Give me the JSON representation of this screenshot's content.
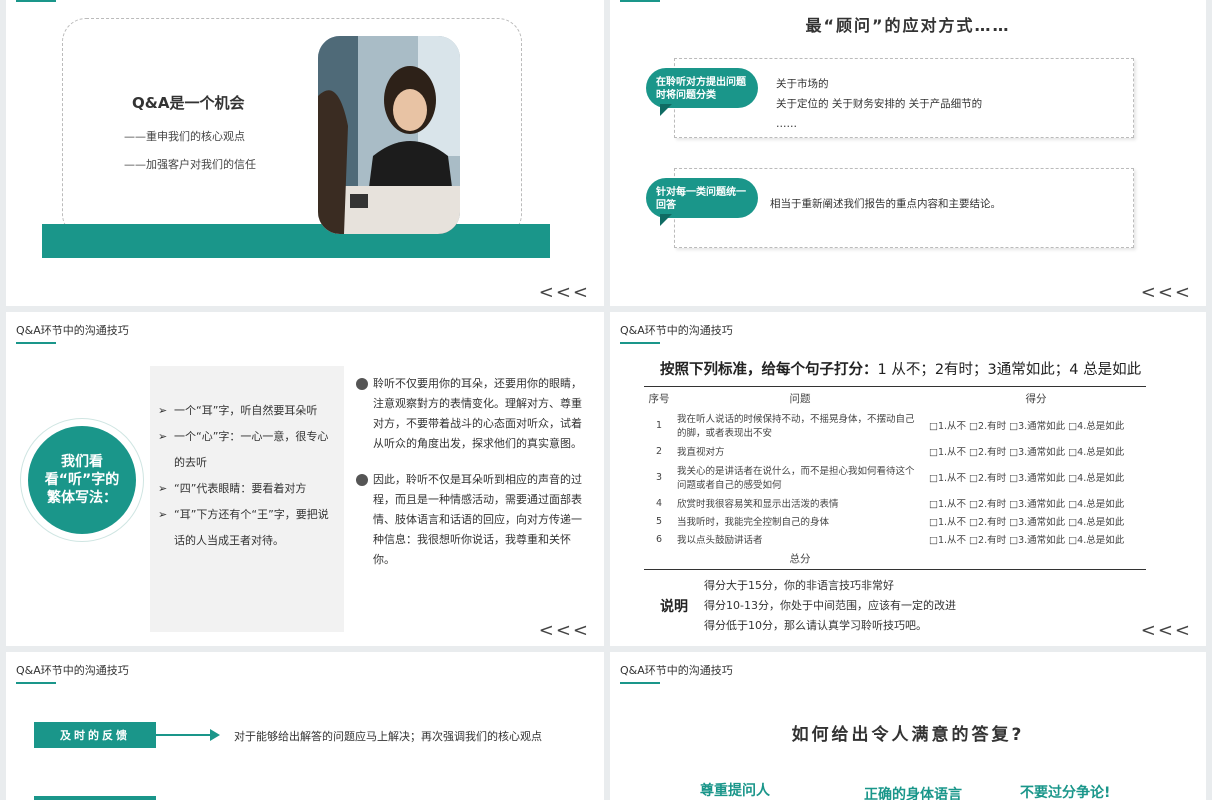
{
  "colors": {
    "accent": "#1a968a",
    "bg": "#e9ecee"
  },
  "nav_arrows": "<<<",
  "slide1": {
    "title": "Q&A是一个机会",
    "lines": [
      "——重申我们的核心观点",
      "——加强客户对我们的信任"
    ]
  },
  "slide2": {
    "title": "最“顾问”的应对方式……",
    "items": [
      {
        "bubble": "在聆听对方提出问题时将问题分类",
        "text": [
          "关于市场的",
          "关于定位的 关于财务安排的 关于产品细节的",
          "……"
        ]
      },
      {
        "bubble": "针对每一类问题统一回答",
        "text": [
          "相当于重新阐述我们报告的重点内容和主要结论。"
        ]
      }
    ]
  },
  "slide3": {
    "header": "Q&A环节中的沟通技巧",
    "circle_text": "我们看看“听”字的繁体写法：",
    "bullets": [
      "一个“耳”字，听自然要耳朵听",
      "一个“心”字：一心一意，很专心的去听",
      "“四”代表眼睛：要看着对方",
      "“耳”下方还有个“王”字，要把说话的人当成王者对待。"
    ],
    "paragraphs": [
      "聆听不仅要用你的耳朵，还要用你的眼睛，注意观察對方的表情变化。理解对方、尊重对方，不要带着战斗的心态面对听众，试着从听众的角度出发，探求他们的真实意图。",
      "因此，聆听不仅是耳朵听到相应的声音的过程，而且是一种情感活动，需要通过面部表情、肢体语言和话语的回应，向对方传递一种信息：我很想听你说话，我尊重和关怀你。"
    ]
  },
  "slide4": {
    "header": "Q&A环节中的沟通技巧",
    "title_bold": "按照下列标准，给每个句子打分：",
    "title_rest": "1 从不；2有时；3通常如此；4 总是如此",
    "columns": [
      "序号",
      "问题",
      "得分"
    ],
    "rows": [
      {
        "no": "1",
        "q": "我在听人说话的时候保持不动，不摇晃身体，不摆动自己的脚，或者表现出不安"
      },
      {
        "no": "2",
        "q": "我直视对方"
      },
      {
        "no": "3",
        "q": "我关心的是讲话者在说什么，而不是担心我如何看待这个问题或者自己的感受如何"
      },
      {
        "no": "4",
        "q": "欣赏时我很容易笑和显示出活泼的表情"
      },
      {
        "no": "5",
        "q": "当我听时，我能完全控制自己的身体"
      },
      {
        "no": "6",
        "q": "我以点头鼓励讲话者"
      }
    ],
    "options": "□1.从不  □2.有时  □3.通常如此  □4.总是如此",
    "total_label": "总分",
    "note_label": "说明",
    "notes": [
      "得分大于15分，你的非语言技巧非常好",
      "得分10-13分，你处于中间范围，应该有一定的改进",
      "得分低于10分，那么请认真学习聆听技巧吧。"
    ]
  },
  "slide5": {
    "header": "Q&A环节中的沟通技巧",
    "tag": "及时的反馈",
    "text": "对于能够给出解答的问题应马上解决；再次强调我们的核心观点"
  },
  "slide6": {
    "header": "Q&A环节中的沟通技巧",
    "title": "如何给出令人满意的答复?",
    "items": [
      "尊重提问人",
      "正确的身体语言",
      "不要过分争论!"
    ]
  }
}
